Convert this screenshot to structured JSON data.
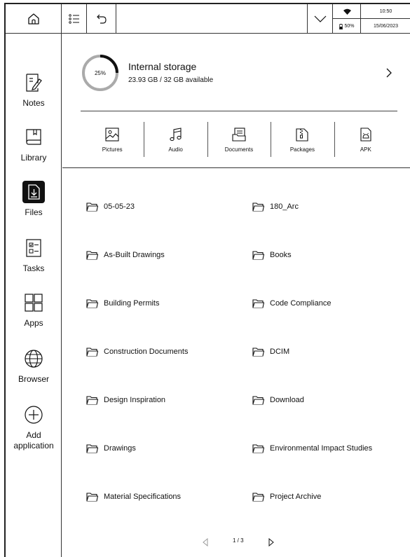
{
  "status": {
    "battery": "50%",
    "time": "10:50",
    "date": "15/06/2023"
  },
  "sidebar": {
    "items": [
      {
        "label": "Notes",
        "icon": "notes-icon"
      },
      {
        "label": "Library",
        "icon": "library-icon"
      },
      {
        "label": "Files",
        "icon": "files-icon",
        "active": true
      },
      {
        "label": "Tasks",
        "icon": "tasks-icon"
      },
      {
        "label": "Apps",
        "icon": "apps-icon"
      },
      {
        "label": "Browser",
        "icon": "globe-icon"
      },
      {
        "label": "Add\napplication",
        "icon": "plus-circle-icon"
      }
    ]
  },
  "storage": {
    "percent_label": "25%",
    "used_fraction": 0.25,
    "title": "Internal storage",
    "subtitle": "23.93 GB / 32 GB available"
  },
  "categories": [
    {
      "label": "Pictures",
      "icon": "picture-icon"
    },
    {
      "label": "Audio",
      "icon": "music-icon"
    },
    {
      "label": "Documents",
      "icon": "documents-icon"
    },
    {
      "label": "Packages",
      "icon": "package-icon"
    },
    {
      "label": "APK",
      "icon": "android-icon"
    }
  ],
  "folders": [
    "05-05-23",
    "180_Arc",
    "As-Built Drawings",
    "Books",
    "Building Permits",
    "Code Compliance",
    "Construction Documents",
    "DCIM",
    "Design Inspiration",
    "Download",
    "Drawings",
    "Environmental Impact Studies",
    "Material Specifications",
    "Project Archive"
  ],
  "pager": {
    "text": "1 / 3"
  }
}
